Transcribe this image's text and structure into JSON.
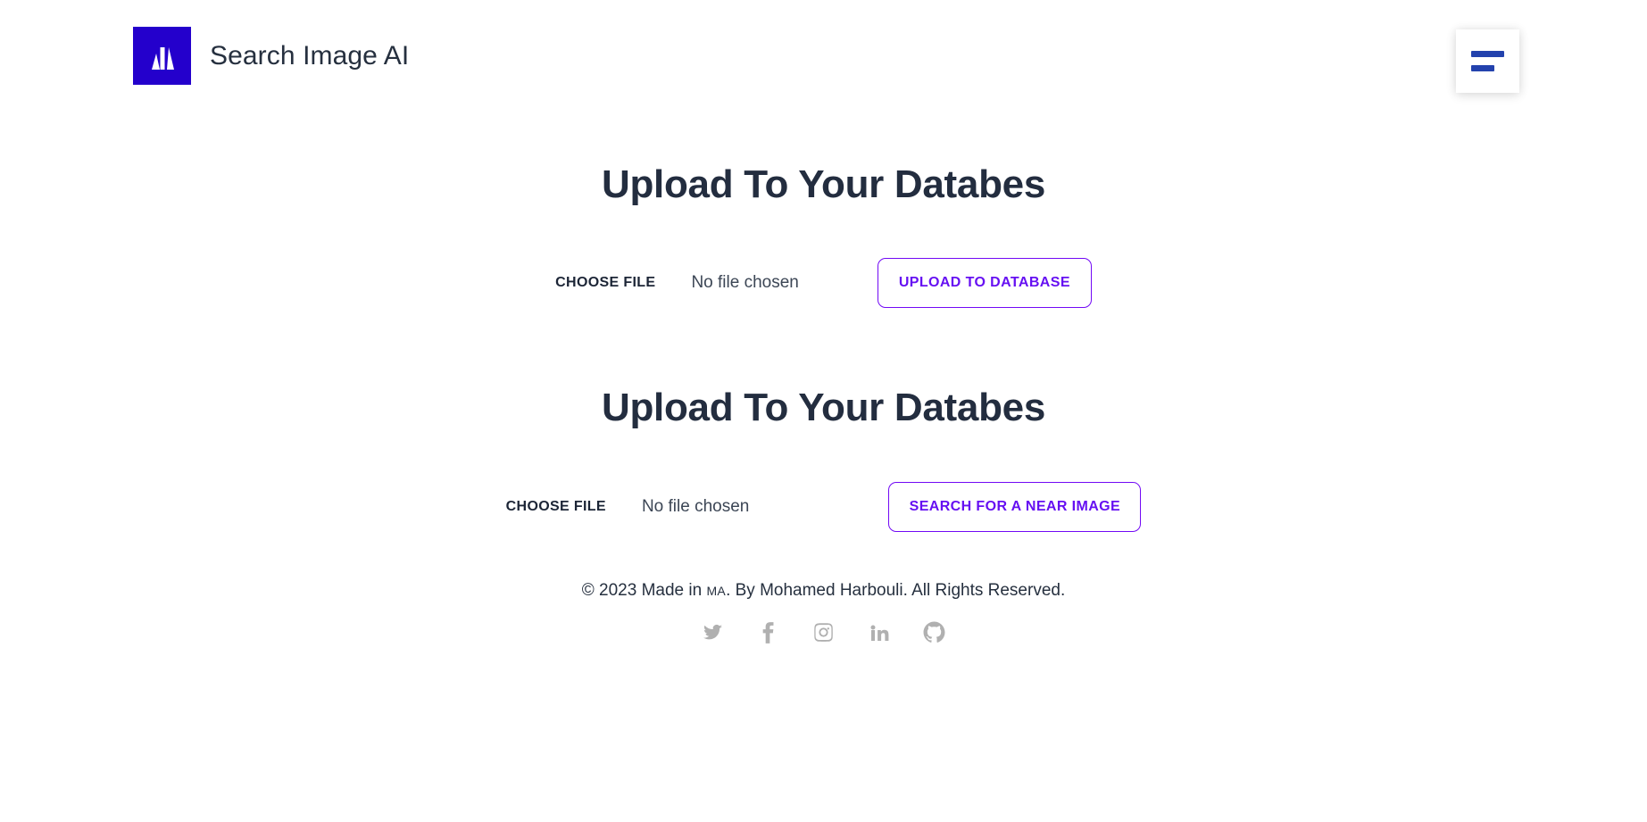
{
  "header": {
    "brand_title": "Search Image AI",
    "logo_icon": "logo-m-mark",
    "logo_bg_color": "#2400cc",
    "menu_icon": "hamburger-menu-icon",
    "menu_bar_color": "#2342ad"
  },
  "main": {
    "upload_section": {
      "title": "Upload To Your Databes",
      "file_label": "CHOOSE FILE",
      "file_status": "No file chosen",
      "action_label": "UPLOAD TO DATABASE"
    },
    "search_section": {
      "title": "Upload To Your Databes",
      "file_label": "CHOOSE FILE",
      "file_status": "No file chosen",
      "action_label": "SEARCH FOR A NEAR IMAGE"
    },
    "accent_color": "#6610f2",
    "heading_color": "#232d3f"
  },
  "footer": {
    "copyright_prefix": "© 2023 Made in ",
    "copyright_region": "MA",
    "copyright_suffix": ". By Mohamed Harbouli. All Rights Reserved.",
    "social": [
      {
        "name": "twitter-icon",
        "label": "Twitter"
      },
      {
        "name": "facebook-icon",
        "label": "Facebook"
      },
      {
        "name": "instagram-icon",
        "label": "Instagram"
      },
      {
        "name": "linkedin-icon",
        "label": "LinkedIn"
      },
      {
        "name": "github-icon",
        "label": "GitHub"
      }
    ],
    "icon_color": "#b0b0b0"
  }
}
